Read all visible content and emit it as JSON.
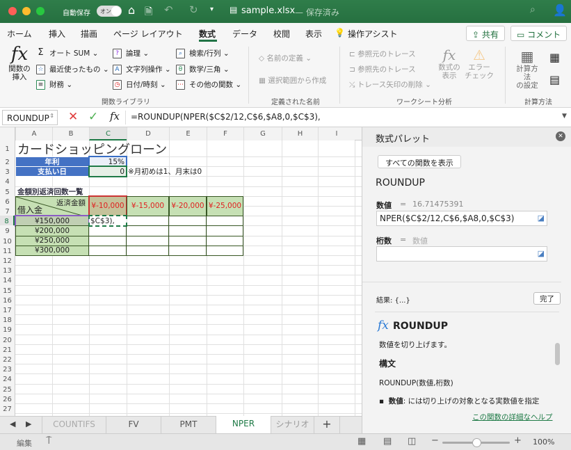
{
  "window": {
    "autosave_label": "自動保存",
    "autosave_toggle": "オン",
    "filename": "sample.xlsx",
    "save_state": "— 保存済み"
  },
  "tabs": [
    "ホーム",
    "挿入",
    "描画",
    "ページ レイアウト",
    "数式",
    "データ",
    "校閲",
    "表示",
    "操作アシスト"
  ],
  "active_tab": "数式",
  "share_label": "共有",
  "comment_label": "コメント",
  "ribbon": {
    "insert_function": "関数の\n挿入",
    "lib": [
      "オート SUM",
      "最近使ったもの",
      "財務",
      "論理",
      "文字列操作",
      "日付/時刻",
      "検索/行列",
      "数学/三角",
      "その他の関数"
    ],
    "lib_group": "関数ライブラリ",
    "names": [
      "名前の定義",
      "選択範囲から作成"
    ],
    "names_group": "定義された名前",
    "audit": [
      "参照元のトレース",
      "参照先のトレース",
      "トレース矢印の削除"
    ],
    "show_formulas": "数式の\n表示",
    "error_check": "エラー\nチェック",
    "audit_group": "ワークシート分析",
    "calc_options": "計算方法\nの設定",
    "calc_group": "計算方法"
  },
  "formula_bar": {
    "name_box": "ROUNDUP",
    "formula": "=ROUNDUP(NPER($C$2/12,C$6,$A8,0,$C$3),"
  },
  "columns": [
    "A",
    "B",
    "C",
    "D",
    "E",
    "F",
    "G",
    "H",
    "I"
  ],
  "active_column": "C",
  "active_row": 8,
  "sheet": {
    "title": "カードショッピングローン",
    "rate_label": "年利",
    "rate_value": "15%",
    "payday_label": "支払い日",
    "payday_value": "0",
    "payday_note": "※月初めは1、月末は0",
    "table_title": "金額別返済回数一覧",
    "corner_top": "返済金額",
    "corner_bottom": "借入金",
    "payments": [
      "¥-10,000",
      "¥-15,000",
      "¥-20,000",
      "¥-25,000"
    ],
    "loans": [
      "¥150,000",
      "¥200,000",
      "¥250,000",
      "¥300,000"
    ],
    "editing_cell": "$C$3),"
  },
  "panel": {
    "title": "数式パレット",
    "show_all": "すべての関数を表示",
    "function": "ROUNDUP",
    "arg1_label": "数値",
    "arg1_result": "16.71475391",
    "arg1_value": "NPER($C$2/12,C$6,$A8,0,$C$3)",
    "arg2_label": "桁数",
    "arg2_result": "数値",
    "arg2_value": "",
    "result": "結果: {...}",
    "done": "完了",
    "help_title": "ROUNDUP",
    "help_desc": "数値を切り上げます。",
    "syntax_head": "構文",
    "syntax": "ROUNDUP(数値,桁数)",
    "bullet_term": "数値",
    "bullet_text": ": には切り上げの対象となる実数値を指定",
    "help_link": "この関数の詳細なヘルプ"
  },
  "sheet_tabs": [
    "COUNTIFS",
    "FV",
    "PMT",
    "NPER",
    "シナリオ"
  ],
  "active_sheet": "NPER",
  "status": {
    "mode": "編集",
    "zoom": "100%",
    "zoom_level": 0.5
  },
  "colors": {
    "excel_green": "#217346",
    "header_blue": "#4472c4",
    "table_green": "#c6e0b4",
    "negative_red": "#e02020"
  }
}
